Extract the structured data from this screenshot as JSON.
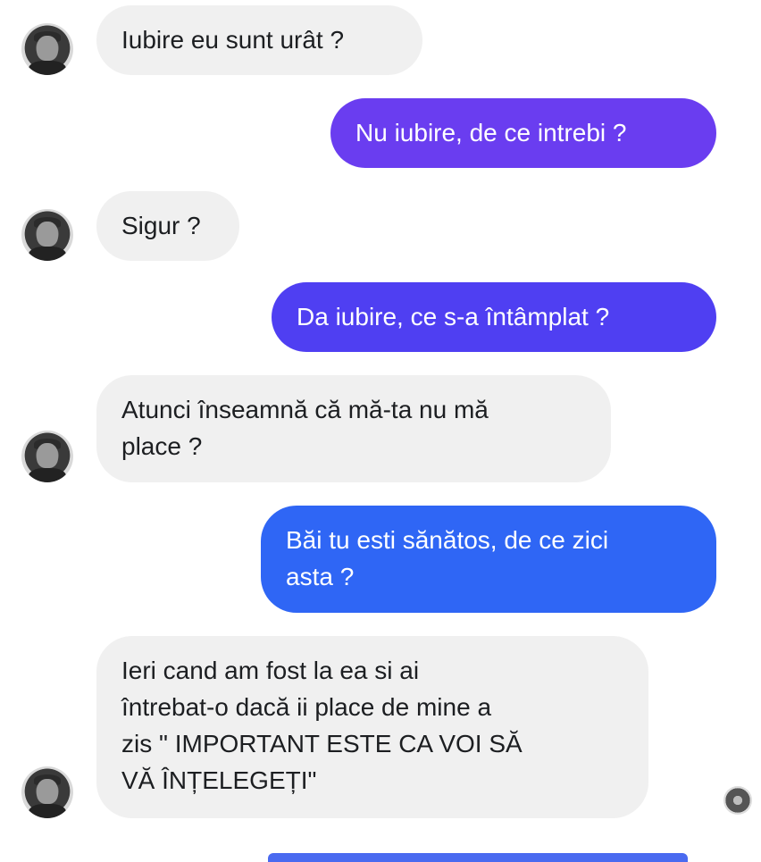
{
  "messages": [
    {
      "id": "m1",
      "direction": "incoming",
      "text": "Iubire eu sunt urât ?"
    },
    {
      "id": "m2",
      "direction": "outgoing",
      "text": "Nu iubire, de ce intrebi ?",
      "color": "#6a3df0"
    },
    {
      "id": "m3",
      "direction": "incoming",
      "text": "Sigur ?"
    },
    {
      "id": "m4",
      "direction": "outgoing",
      "text": "Da iubire, ce s-a întâmplat  ?",
      "color": "#4f3ff2"
    },
    {
      "id": "m5",
      "direction": "incoming",
      "text": "Atunci înseamnă că mă-ta nu mă\nplace ?"
    },
    {
      "id": "m6",
      "direction": "outgoing",
      "text": "Băi tu esti sănătos, de ce zici\nasta ?",
      "color": "#2f66f5"
    },
    {
      "id": "m7",
      "direction": "incoming",
      "text": "Ieri cand am fost la ea si ai\nîntrebat-o dacă ii place de mine  a\nzis \" IMPORTANT ESTE CA VOI SĂ\nVĂ ÎNȚELEGEȚI\""
    }
  ],
  "colors": {
    "incoming_bg": "#f0f0f0",
    "text": "#1c1e21",
    "outgoing_text": "#ffffff"
  },
  "icons": {
    "avatar": "contact-avatar",
    "seen": "seen-avatar-icon"
  }
}
